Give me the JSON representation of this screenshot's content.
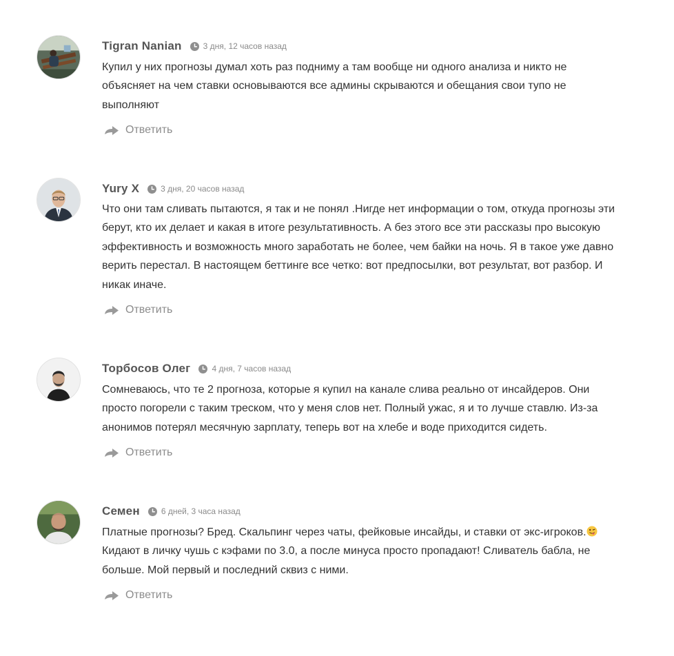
{
  "comments": [
    {
      "author": "Tigran Nanian",
      "time": "3 дня, 12 часов назад",
      "lines": [
        "Купил у них прогнозы думал хоть раз подниму а там вообще ни одного анализа и никто не",
        "объясняет на чем ставки основываются все админы скрываются и обещания свои тупо не",
        "выполняют"
      ],
      "reply_label": "Ответить"
    },
    {
      "author": "Yury X",
      "time": "3 дня, 20 часов назад",
      "lines": [
        "Что они там сливать пытаются, я так и не понял .Нигде нет информации о том, откуда прогнозы эти",
        "берут, кто их делает и какая в итоге результативность. А без этого все эти рассказы про высокую",
        "эффективность и возможность много заработать не более, чем байки на ночь. Я в такое уже давно",
        "верить перестал. В настоящем беттинге все четко: вот предпосылки, вот результат, вот разбор. И",
        "никак иначе."
      ],
      "reply_label": "Ответить"
    },
    {
      "author": "Торбосов Олег",
      "time": "4 дня, 7 часов назад",
      "lines": [
        "Сомневаюсь, что те 2 прогноза, которые я купил на канале слива реально от инсайдеров. Они",
        "просто погорели с таким треском, что у меня слов нет. Полный ужас, я и то лучше ставлю. Из-за",
        "анонимов потерял месячную зарплату, теперь вот на хлебе и воде приходится сидеть."
      ],
      "reply_label": "Ответить"
    },
    {
      "author": "Семен",
      "time": "6 дней, 3 часа назад",
      "lines": [
        "Платные прогнозы? Бред. Скальпинг через чаты, фейковые инсайды, и ставки от экс-игроков.",
        "Кидают в личку чушь с кэфами по 3.0, а после минуса просто пропадают! Сливатель бабла, не",
        "больше. Мой первый и последний сквиз с ними."
      ],
      "reply_label": "Ответить"
    }
  ],
  "icons": {
    "clock": "clock-icon",
    "reply": "reply-arrow-icon",
    "emoji": "winking-face-with-tongue-emoji"
  },
  "colors": {
    "author": "#555555",
    "time": "#8a8a8a",
    "text": "#333333",
    "reply": "#8c8c8c"
  }
}
